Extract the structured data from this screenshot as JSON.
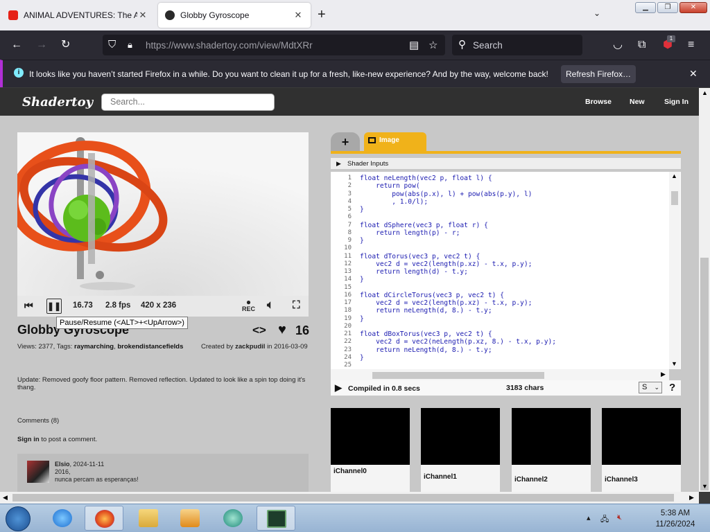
{
  "browser": {
    "tabs": [
      {
        "title": "ANIMAL ADVENTURES: The Ani",
        "favicon_color": "#e62117"
      },
      {
        "title": "Globby Gyroscope",
        "favicon_color": "#2a2a2a"
      }
    ],
    "url": "https://www.shadertoy.com/view/MdtXRr",
    "search_placeholder": "Search",
    "extension_badge": "1",
    "notification": {
      "message": "It looks like you haven’t started Firefox in a while. Do you want to clean it up for a fresh, like-new experience? And by the way, welcome back!",
      "button": "Refresh Firefox…"
    }
  },
  "site": {
    "logo": "Shadertoy",
    "search_placeholder": "Search...",
    "nav": [
      "Browse",
      "New",
      "Sign In"
    ]
  },
  "player": {
    "time": "16.73",
    "fps": "2.8 fps",
    "resolution": "420 x 236",
    "rec_label": "REC",
    "tooltip": "Pause/Resume (<ALT>+<UpArrow>)"
  },
  "shader": {
    "title": "Globby Gyroscope",
    "likes": "16",
    "views_prefix": "Views: 2377, Tags:",
    "tags": [
      "raymarching",
      "brokendistancefields"
    ],
    "created_prefix": "Created by",
    "author": "zackpudil",
    "created_suffix": "in 2016-03-09",
    "description": "Update: Removed goofy floor pattern. Removed reflection.  Updated to look like a spin top doing it's thang.",
    "comments_label": "Comments (8)",
    "signin_link": "Sign in",
    "signin_suffix": "to post a comment.",
    "comment": {
      "author": "Elsio",
      "date": ", 2024-11-11",
      "line1": "2016,",
      "line2": " nunca percam as esperanças!"
    }
  },
  "editor": {
    "tab_label": "Image",
    "plus_label": "+",
    "shader_inputs": "Shader Inputs",
    "code_lines": [
      "float neLength(vec2 p, float l) {",
      "    return pow(",
      "        pow(abs(p.x), l) + pow(abs(p.y), l)",
      "        , 1.0/l);",
      "}",
      "",
      "float dSphere(vec3 p, float r) {",
      "    return length(p) - r;",
      "}",
      "",
      "float dTorus(vec3 p, vec2 t) {",
      "    vec2 d = vec2(length(p.xz) - t.x, p.y);",
      "    return length(d) - t.y;",
      "}",
      "",
      "float dCircleTorus(vec3 p, vec2 t) {",
      "    vec2 d = vec2(length(p.xz) - t.x, p.y);",
      "    return neLength(d, 8.) - t.y;",
      "}",
      "",
      "float dBoxTorus(vec3 p, vec2 t) {",
      "    vec2 d = vec2(neLength(p.xz, 8.) - t.x, p.y);",
      "    return neLength(d, 8.) - t.y;",
      "}",
      "",
      ""
    ],
    "compiled": "Compiled in 0.8 secs",
    "chars": "3183 chars",
    "font_size_option": "S",
    "help": "?",
    "channels": [
      "iChannel0",
      "iChannel1",
      "iChannel2",
      "iChannel3"
    ]
  },
  "taskbar": {
    "time": "5:38 AM",
    "date": "11/26/2024"
  }
}
